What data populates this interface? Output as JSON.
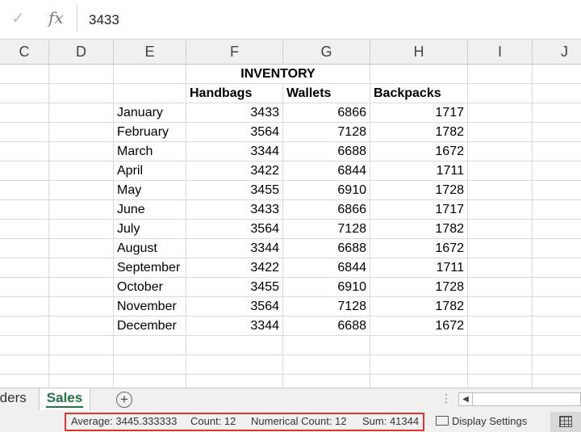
{
  "formula_bar": {
    "check_icon": "checkmark-icon",
    "fx_label": "fx",
    "value": "3433"
  },
  "columns": [
    "C",
    "D",
    "E",
    "F",
    "G",
    "H",
    "I",
    "J"
  ],
  "sheet": {
    "title": "INVENTORY",
    "headers": [
      "Handbags",
      "Wallets",
      "Backpacks"
    ],
    "rows": [
      {
        "month": "January",
        "handbags": "3433",
        "wallets": "6866",
        "backpacks": "1717"
      },
      {
        "month": "February",
        "handbags": "3564",
        "wallets": "7128",
        "backpacks": "1782"
      },
      {
        "month": "March",
        "handbags": "3344",
        "wallets": "6688",
        "backpacks": "1672"
      },
      {
        "month": "April",
        "handbags": "3422",
        "wallets": "6844",
        "backpacks": "1711"
      },
      {
        "month": "May",
        "handbags": "3455",
        "wallets": "6910",
        "backpacks": "1728"
      },
      {
        "month": "June",
        "handbags": "3433",
        "wallets": "6866",
        "backpacks": "1717"
      },
      {
        "month": "July",
        "handbags": "3564",
        "wallets": "7128",
        "backpacks": "1782"
      },
      {
        "month": "August",
        "handbags": "3344",
        "wallets": "6688",
        "backpacks": "1672"
      },
      {
        "month": "September",
        "handbags": "3422",
        "wallets": "6844",
        "backpacks": "1711"
      },
      {
        "month": "October",
        "handbags": "3455",
        "wallets": "6910",
        "backpacks": "1728"
      },
      {
        "month": "November",
        "handbags": "3564",
        "wallets": "7128",
        "backpacks": "1782"
      },
      {
        "month": "December",
        "handbags": "3344",
        "wallets": "6688",
        "backpacks": "1672"
      }
    ]
  },
  "tabs": {
    "previous": "rders",
    "active": "Sales",
    "add_icon": "plus-circle-icon"
  },
  "status": {
    "average": "Average: 3445.333333",
    "count": "Count: 12",
    "numerical_count": "Numerical Count: 12",
    "sum": "Sum: 41344",
    "display_settings": "Display Settings",
    "accent_color": "#217346",
    "highlight_color": "#e03535"
  }
}
